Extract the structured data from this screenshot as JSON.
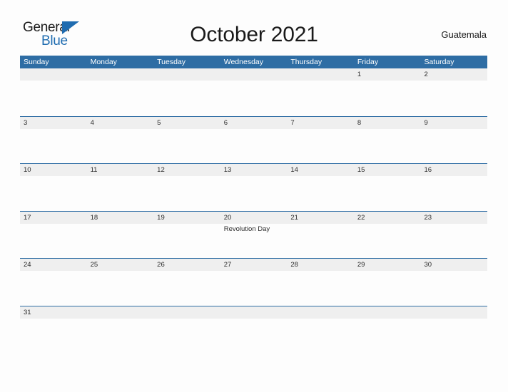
{
  "brand": {
    "name_part1": "General",
    "name_part2": "Blue",
    "triangle_color": "#1f6cb0"
  },
  "header": {
    "title": "October 2021",
    "country": "Guatemala"
  },
  "theme": {
    "header_blue": "#2e6da4",
    "band_gray": "#efefef",
    "page_background": "#fdfdfd",
    "text_color": "#2b2b2b"
  },
  "calendar": {
    "weekday_names": [
      "Sunday",
      "Monday",
      "Tuesday",
      "Wednesday",
      "Thursday",
      "Friday",
      "Saturday"
    ],
    "weeks": [
      {
        "days": [
          {
            "date": "",
            "events": []
          },
          {
            "date": "",
            "events": []
          },
          {
            "date": "",
            "events": []
          },
          {
            "date": "",
            "events": []
          },
          {
            "date": "",
            "events": []
          },
          {
            "date": "1",
            "events": []
          },
          {
            "date": "2",
            "events": []
          }
        ]
      },
      {
        "days": [
          {
            "date": "3",
            "events": []
          },
          {
            "date": "4",
            "events": []
          },
          {
            "date": "5",
            "events": []
          },
          {
            "date": "6",
            "events": []
          },
          {
            "date": "7",
            "events": []
          },
          {
            "date": "8",
            "events": []
          },
          {
            "date": "9",
            "events": []
          }
        ]
      },
      {
        "days": [
          {
            "date": "10",
            "events": []
          },
          {
            "date": "11",
            "events": []
          },
          {
            "date": "12",
            "events": []
          },
          {
            "date": "13",
            "events": []
          },
          {
            "date": "14",
            "events": []
          },
          {
            "date": "15",
            "events": []
          },
          {
            "date": "16",
            "events": []
          }
        ]
      },
      {
        "days": [
          {
            "date": "17",
            "events": []
          },
          {
            "date": "18",
            "events": []
          },
          {
            "date": "19",
            "events": []
          },
          {
            "date": "20",
            "events": [
              "Revolution Day"
            ]
          },
          {
            "date": "21",
            "events": []
          },
          {
            "date": "22",
            "events": []
          },
          {
            "date": "23",
            "events": []
          }
        ]
      },
      {
        "days": [
          {
            "date": "24",
            "events": []
          },
          {
            "date": "25",
            "events": []
          },
          {
            "date": "26",
            "events": []
          },
          {
            "date": "27",
            "events": []
          },
          {
            "date": "28",
            "events": []
          },
          {
            "date": "29",
            "events": []
          },
          {
            "date": "30",
            "events": []
          }
        ]
      },
      {
        "days": [
          {
            "date": "31",
            "events": []
          },
          {
            "date": "",
            "events": []
          },
          {
            "date": "",
            "events": []
          },
          {
            "date": "",
            "events": []
          },
          {
            "date": "",
            "events": []
          },
          {
            "date": "",
            "events": []
          },
          {
            "date": "",
            "events": []
          }
        ]
      }
    ]
  }
}
